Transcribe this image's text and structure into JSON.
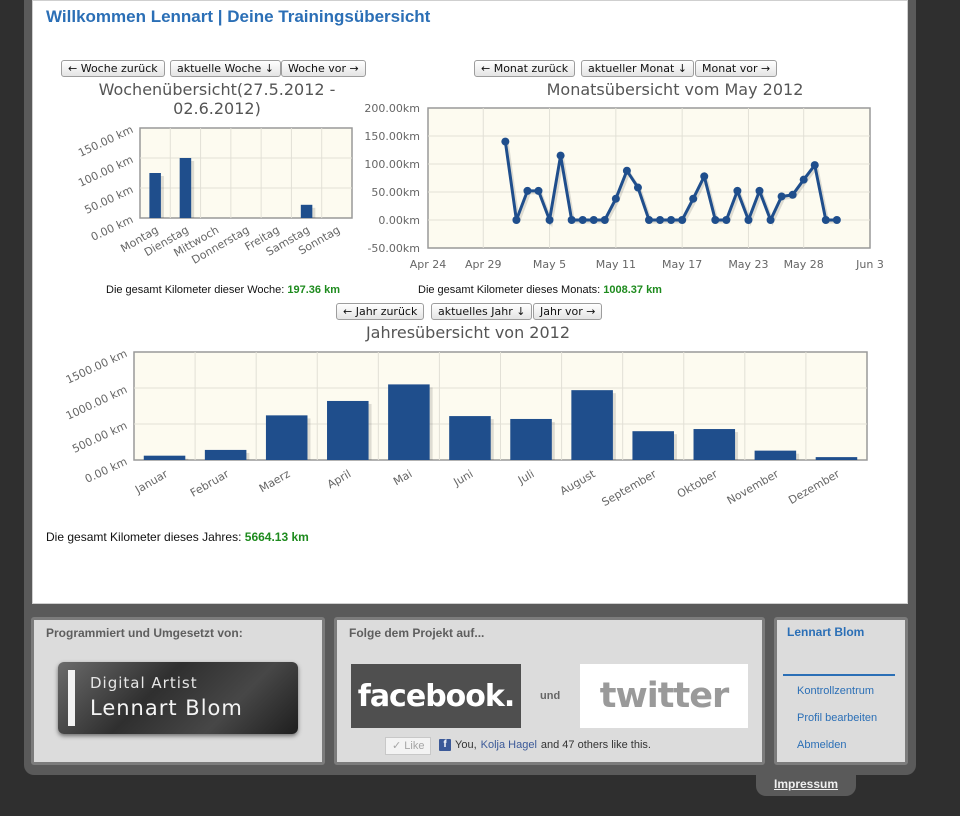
{
  "header": {
    "title": "Willkommen Lennart | Deine Trainingsübersicht"
  },
  "week": {
    "buttons": {
      "prev": "← Woche zurück",
      "current": "aktuelle Woche ↓",
      "next": "Woche vor →"
    },
    "title": "Wochenübersicht(27.5.2012 - 02.6.2012)",
    "total_label": "Die gesamt Kilometer dieser Woche:",
    "total_value": "197.36 km"
  },
  "month": {
    "buttons": {
      "prev": "← Monat zurück",
      "current": "aktueller Monat ↓",
      "next": "Monat vor →"
    },
    "title": "Monatsübersicht vom May 2012",
    "total_label": "Die gesamt Kilometer dieses Monats:",
    "total_value": "1008.37 km"
  },
  "year": {
    "buttons": {
      "prev": "← Jahr zurück",
      "current": "aktuelles Jahr ↓",
      "next": "Jahr vor →"
    },
    "title": "Jahresübersicht von 2012",
    "total_label": "Die gesamt Kilometer dieses Jahres:",
    "total_value": "5664.13 km"
  },
  "chart_data": [
    {
      "id": "week",
      "type": "bar",
      "title": "Wochenübersicht(27.5.2012 - 02.6.2012)",
      "categories": [
        "Montag",
        "Dienstag",
        "Mittwoch",
        "Donnerstag",
        "Freitag",
        "Samstag",
        "Sonntag"
      ],
      "values": [
        75,
        100,
        0,
        0,
        0,
        22,
        0
      ],
      "ylim": [
        0,
        150
      ],
      "yticks": [
        "0.00 km",
        "50.00 km",
        "100.00 km",
        "150.00 km"
      ],
      "bar_color": "#1f4e8c",
      "background": "#fdfbf0",
      "grid": true
    },
    {
      "id": "month",
      "type": "line",
      "title": "Monatsübersicht vom May 2012",
      "x_ticks": [
        "Apr 24",
        "Apr 29",
        "May 5",
        "May 11",
        "May 17",
        "May 23",
        "May 28",
        "Jun 3"
      ],
      "x_tick_days": [
        -7,
        -2,
        4,
        10,
        16,
        22,
        27,
        33
      ],
      "points": [
        {
          "day": 0,
          "value": 140
        },
        {
          "day": 1,
          "value": 0
        },
        {
          "day": 2,
          "value": 52
        },
        {
          "day": 3,
          "value": 52
        },
        {
          "day": 4,
          "value": 0
        },
        {
          "day": 5,
          "value": 115
        },
        {
          "day": 6,
          "value": 0
        },
        {
          "day": 7,
          "value": 0
        },
        {
          "day": 8,
          "value": 0
        },
        {
          "day": 9,
          "value": 0
        },
        {
          "day": 10,
          "value": 38
        },
        {
          "day": 11,
          "value": 88
        },
        {
          "day": 12,
          "value": 58
        },
        {
          "day": 13,
          "value": 0
        },
        {
          "day": 14,
          "value": 0
        },
        {
          "day": 15,
          "value": 0
        },
        {
          "day": 16,
          "value": 0
        },
        {
          "day": 17,
          "value": 38
        },
        {
          "day": 18,
          "value": 78
        },
        {
          "day": 19,
          "value": 0
        },
        {
          "day": 20,
          "value": 0
        },
        {
          "day": 21,
          "value": 52
        },
        {
          "day": 22,
          "value": 0
        },
        {
          "day": 23,
          "value": 52
        },
        {
          "day": 24,
          "value": 0
        },
        {
          "day": 25,
          "value": 42
        },
        {
          "day": 26,
          "value": 45
        },
        {
          "day": 27,
          "value": 72
        },
        {
          "day": 28,
          "value": 98
        },
        {
          "day": 29,
          "value": 0
        },
        {
          "day": 30,
          "value": 0
        }
      ],
      "xlim": [
        -7,
        33
      ],
      "ylim": [
        -50,
        200
      ],
      "yticks": [
        "-50.00km",
        "0.00km",
        "50.00km",
        "100.00km",
        "150.00km",
        "200.00km"
      ],
      "line_color": "#1f4e8c",
      "background": "#fdfbf0",
      "grid": true
    },
    {
      "id": "year",
      "type": "bar",
      "title": "Jahresübersicht von 2012",
      "categories": [
        "Januar",
        "Februar",
        "Maerz",
        "April",
        "Mai",
        "Juni",
        "Juli",
        "August",
        "September",
        "Oktober",
        "November",
        "Dezember"
      ],
      "values": [
        60,
        140,
        620,
        820,
        1050,
        610,
        570,
        970,
        400,
        430,
        130,
        40
      ],
      "ylim": [
        0,
        1500
      ],
      "yticks": [
        "0.00 km",
        "500.00 km",
        "1000.00 km",
        "1500.00 km"
      ],
      "bar_color": "#1f4e8c",
      "background": "#fdfbf0",
      "grid": true
    }
  ],
  "footer": {
    "credits": {
      "heading": "Programmiert und Umgesetzt von:",
      "logo_line1": "Digital Artist",
      "logo_line2": "Lennart Blom"
    },
    "social": {
      "heading": "Folge dem Projekt auf...",
      "facebook": "facebook.",
      "und": "und",
      "twitter": "twitter",
      "like_button": "✓ Like",
      "like_you": "You,",
      "like_link": "Kolja Hagel",
      "like_rest": "and 47 others like this."
    },
    "user": {
      "name": "Lennart Blom",
      "links": [
        "Kontrollzentrum",
        "Profil bearbeiten",
        "Abmelden"
      ]
    }
  },
  "impressum": "Impressum",
  "colors": {
    "accent": "#2b6fb6",
    "total_value": "#1e8b1e",
    "series": "#1f4e8c"
  }
}
